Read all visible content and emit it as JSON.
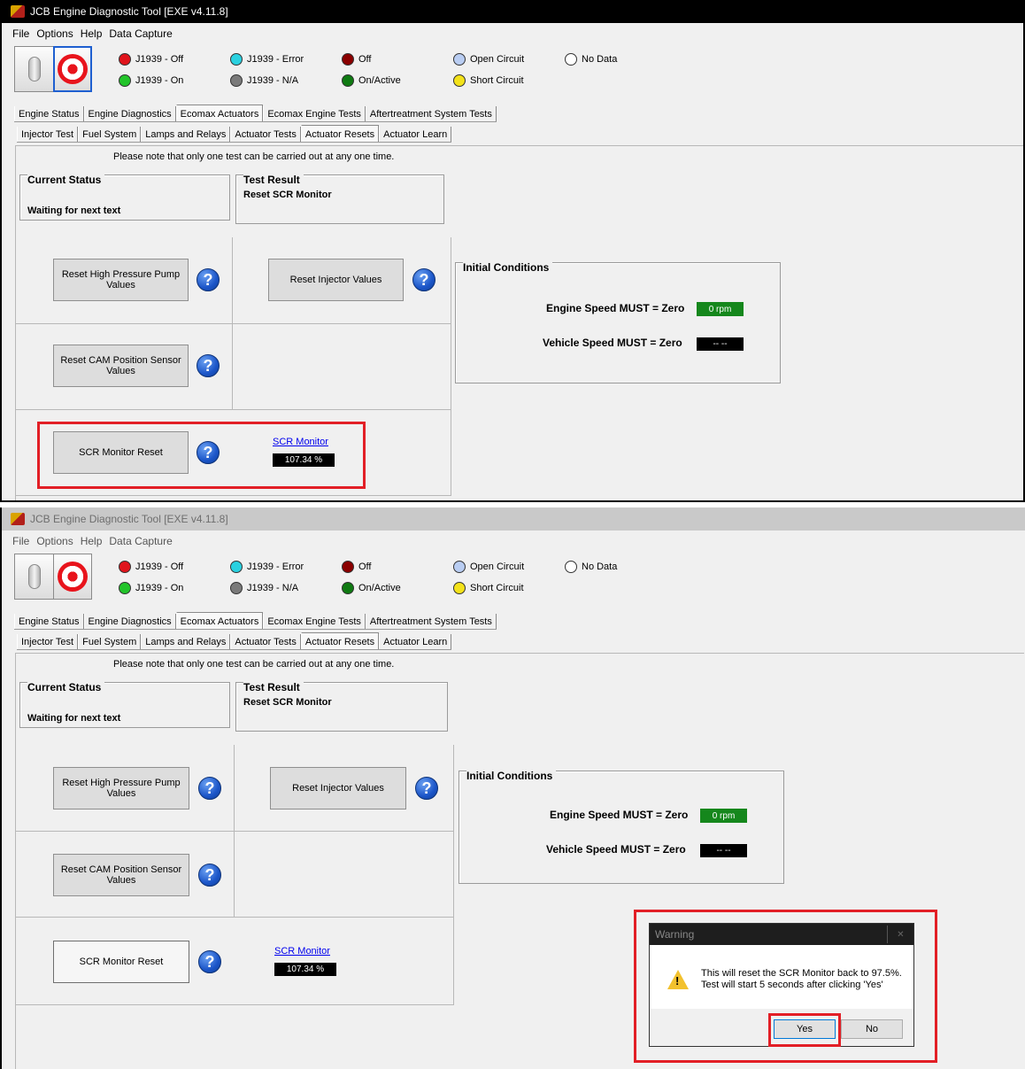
{
  "window": {
    "title": "JCB Engine Diagnostic Tool [EXE v4.11.8]"
  },
  "menu": [
    "File",
    "Options",
    "Help",
    "Data Capture"
  ],
  "legend": [
    {
      "label": "J1939 - Off",
      "color": "#e0141c"
    },
    {
      "label": "J1939 - On",
      "color": "#22c42a"
    },
    {
      "label": "J1939 - Error",
      "color": "#2ad1e0"
    },
    {
      "label": "J1939 - N/A",
      "color": "#7a7a7a"
    },
    {
      "label": "Off",
      "color": "#8a0000"
    },
    {
      "label": "On/Active",
      "color": "#0f7a12"
    },
    {
      "label": "Open Circuit",
      "color": "#b9cdf2"
    },
    {
      "label": "Short Circuit",
      "color": "#f3e21a"
    },
    {
      "label": "No Data",
      "color": "#ffffff"
    }
  ],
  "main_tabs": [
    "Engine Status",
    "Engine Diagnostics",
    "Ecomax Actuators",
    "Ecomax Engine Tests",
    "Aftertreatment System Tests"
  ],
  "sub_tabs": [
    "Injector Test",
    "Fuel System",
    "Lamps and Relays",
    "Actuator Tests",
    "Actuator Resets",
    "Actuator Learn"
  ],
  "note": "Please note that only one test can be carried out at any one time.",
  "current_status": {
    "title": "Current Status",
    "value": "Waiting for next text"
  },
  "test_result": {
    "title": "Test Result",
    "value": "Reset SCR Monitor"
  },
  "buttons": {
    "hpp": "Reset High Pressure Pump Values",
    "injector": "Reset Injector Values",
    "cam": "Reset CAM Position Sensor Values",
    "scr": "SCR Monitor Reset",
    "help": "?"
  },
  "scr_monitor": {
    "label": "SCR Monitor",
    "value": "107.34 %"
  },
  "initial_conditions": {
    "title": "Initial Conditions",
    "engine_label": "Engine Speed MUST = Zero",
    "engine_value": "0 rpm",
    "vehicle_label": "Vehicle Speed MUST = Zero",
    "vehicle_value": "-- --"
  },
  "dialog": {
    "title": "Warning",
    "message_line1": "This will reset the SCR Monitor back to 97.5%.",
    "message_line2": "Test will start 5 seconds after clicking 'Yes'",
    "yes": "Yes",
    "no": "No"
  },
  "colors": {
    "highlight": "#e21f26",
    "help_icon": "#1b55c8",
    "ok_green": "#15871c"
  }
}
